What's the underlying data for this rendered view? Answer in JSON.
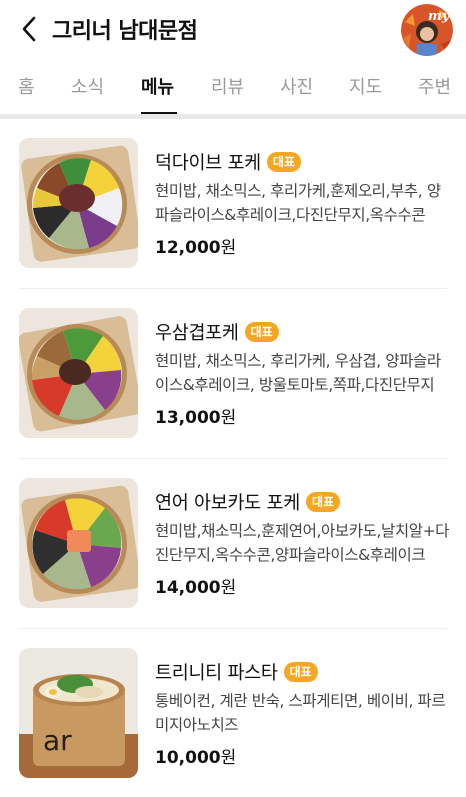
{
  "header": {
    "title": "그리너 남대문점",
    "avatar_text": "my"
  },
  "tabs": [
    {
      "label": "홈"
    },
    {
      "label": "소식"
    },
    {
      "label": "메뉴"
    },
    {
      "label": "리뷰"
    },
    {
      "label": "사진"
    },
    {
      "label": "지도"
    },
    {
      "label": "주변"
    }
  ],
  "active_tab": "메뉴",
  "menu": [
    {
      "name": "덕다이브 포케",
      "badge": "대표",
      "description": "현미밥, 채소믹스, 후리가케,훈제오리,부추, 양파슬라이스&후레이크,다진단무지,옥수수콘",
      "price": "12,000",
      "currency": "원"
    },
    {
      "name": "우삼겹포케",
      "badge": "대표",
      "description": "현미밥, 채소믹스, 후리가케, 우삼겹, 양파슬라이스&후레이크, 방울토마토,쪽파,다진단무지",
      "price": "13,000",
      "currency": "원"
    },
    {
      "name": "연어 아보카도 포케",
      "badge": "대표",
      "description": "현미밥,채소믹스,훈제연어,아보카도,날치알+다진단무지,옥수수콘,양파슬라이스&후레이크",
      "price": "14,000",
      "currency": "원"
    },
    {
      "name": "트리니티 파스타",
      "badge": "대표",
      "description": "통베이컨, 계란 반숙, 스파게티면, 베이비, 파르미지아노치즈",
      "price": "10,000",
      "currency": "원"
    }
  ],
  "colors": {
    "badge": "#f5a623",
    "active_tab": "#111111",
    "inactive_tab": "#9a9a9a"
  },
  "icons": {
    "back": "chevron-left-icon"
  }
}
